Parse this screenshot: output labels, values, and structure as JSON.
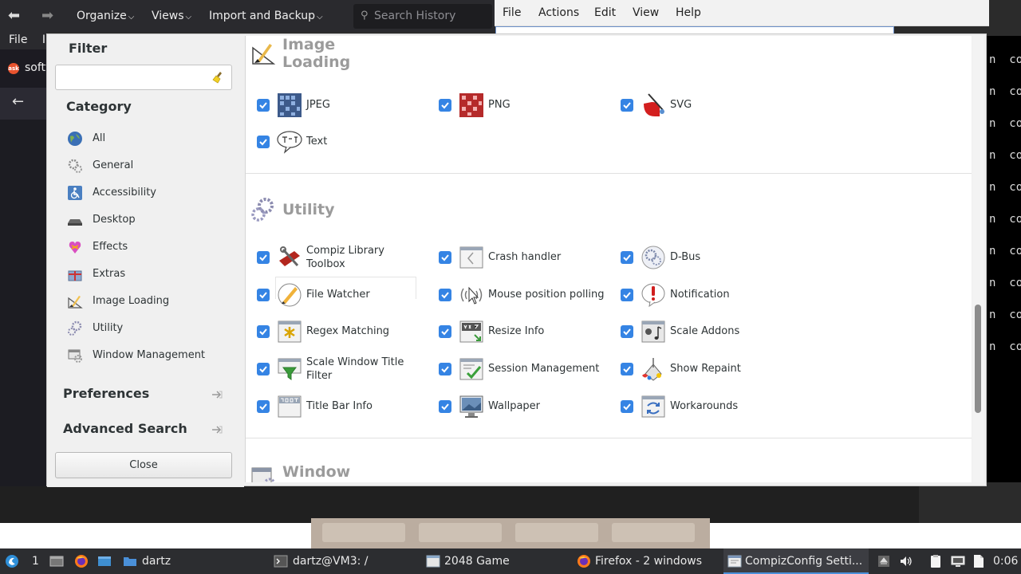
{
  "library": {
    "menus": [
      "Organize",
      "Views",
      "Import and Backup"
    ],
    "search_placeholder": "Search History"
  },
  "firefox": {
    "menu_file": "File",
    "menu_partial": "I",
    "tab_title": "softw",
    "ask_logo": "ask"
  },
  "terminal": {
    "menus": [
      "File",
      "Actions",
      "Edit",
      "View",
      "Help"
    ],
    "line_text": "n  com"
  },
  "dialog": {
    "filter_heading": "Filter",
    "filter_value": "",
    "category_heading": "Category",
    "categories": [
      "All",
      "General",
      "Accessibility",
      "Desktop",
      "Effects",
      "Extras",
      "Image Loading",
      "Utility",
      "Window Management"
    ],
    "preferences": "Preferences",
    "advanced_search": "Advanced Search",
    "close": "Close"
  },
  "sections": {
    "image_loading": {
      "title_line1": "Image",
      "title_line2": "Loading",
      "plugins": [
        "JPEG",
        "PNG",
        "SVG",
        "Text"
      ]
    },
    "utility": {
      "title": "Utility",
      "plugins": [
        "Compiz Library Toolbox",
        "Crash handler",
        "D-Bus",
        "File Watcher",
        "Mouse position polling",
        "Notification",
        "Regex Matching",
        "Resize Info",
        "Scale Addons",
        "Scale Window Title Filter",
        "Session Management",
        "Show Repaint",
        "Title Bar Info",
        "Wallpaper",
        "Workarounds"
      ]
    },
    "window": {
      "title": "Window"
    }
  },
  "taskbar": {
    "workspace": "1",
    "items": [
      "dartz",
      "dartz@VM3: /",
      "2048 Game",
      "Firefox - 2 windows",
      "CompizConfig Setti..."
    ],
    "clock": "0:06"
  },
  "colors": {
    "checkbox": "#3584e4",
    "taskbar": "#2c2d30",
    "section_title": "#9b9b9b"
  }
}
